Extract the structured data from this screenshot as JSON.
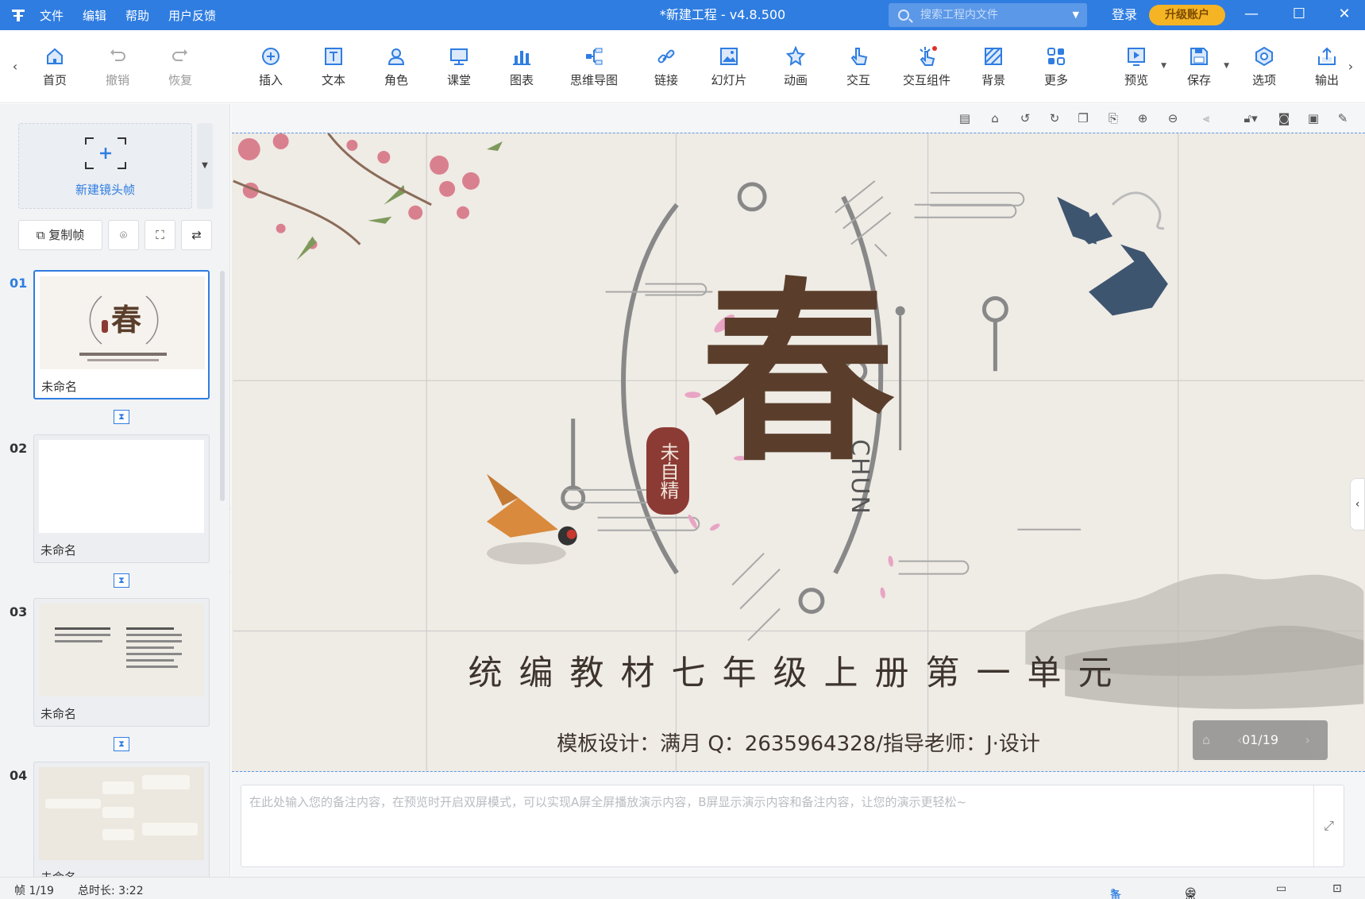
{
  "titlebar": {
    "menu": [
      "文件",
      "编辑",
      "帮助",
      "用户反馈"
    ],
    "title": "*新建工程 - v4.8.500",
    "search_placeholder": "搜索工程内文件",
    "login": "登录",
    "upgrade": "升级账户"
  },
  "toolbar": {
    "items": [
      {
        "label": "首页",
        "icon": "home-icon"
      },
      {
        "label": "撤销",
        "icon": "undo-icon"
      },
      {
        "label": "恢复",
        "icon": "redo-icon"
      },
      {
        "label": "插入",
        "icon": "insert-icon"
      },
      {
        "label": "文本",
        "icon": "text-icon"
      },
      {
        "label": "角色",
        "icon": "role-icon"
      },
      {
        "label": "课堂",
        "icon": "classroom-icon"
      },
      {
        "label": "图表",
        "icon": "chart-icon"
      },
      {
        "label": "思维导图",
        "icon": "mindmap-icon"
      },
      {
        "label": "链接",
        "icon": "link-icon"
      },
      {
        "label": "幻灯片",
        "icon": "slideshow-icon"
      },
      {
        "label": "动画",
        "icon": "animation-icon"
      },
      {
        "label": "交互",
        "icon": "interact-icon"
      },
      {
        "label": "交互组件",
        "icon": "interactive-component-icon"
      },
      {
        "label": "背景",
        "icon": "background-icon"
      },
      {
        "label": "更多",
        "icon": "more-icon"
      },
      {
        "label": "预览",
        "icon": "preview-icon"
      },
      {
        "label": "保存",
        "icon": "save-icon"
      },
      {
        "label": "选项",
        "icon": "options-icon"
      },
      {
        "label": "输出",
        "icon": "export-icon"
      }
    ]
  },
  "leftpanel": {
    "new_frame": "新建镜头帧",
    "copy_frame": "复制帧",
    "slides": [
      {
        "num": "01",
        "name": "未命名",
        "active": true
      },
      {
        "num": "02",
        "name": "未命名",
        "active": false
      },
      {
        "num": "03",
        "name": "未命名",
        "active": false
      },
      {
        "num": "04",
        "name": "未命名",
        "active": false
      }
    ]
  },
  "slide": {
    "big_char": "春",
    "pinyin": "CHUN",
    "seal_text": "未自精",
    "subtitle": "统编教材七年级上册第一单元",
    "credits": "模板设计：满月 Q：2635964328/指导老师：J·设计",
    "pager": "01/19"
  },
  "notes": {
    "placeholder": "在此处输入您的备注内容，在预览时开启双屏模式，可以实现A屏全屏播放演示内容，B屏显示演示内容和备注内容，让您的演示更轻松~"
  },
  "status": {
    "frame": "帧 1/19",
    "duration": "总时长: 3:22",
    "notes_btn": "备注",
    "rollcall_btn": "点名"
  },
  "colors": {
    "accent": "#2f7de1",
    "upgrade": "#f5b424",
    "title_brown": "#5a3e2b",
    "seal_red": "#8c3b34"
  }
}
